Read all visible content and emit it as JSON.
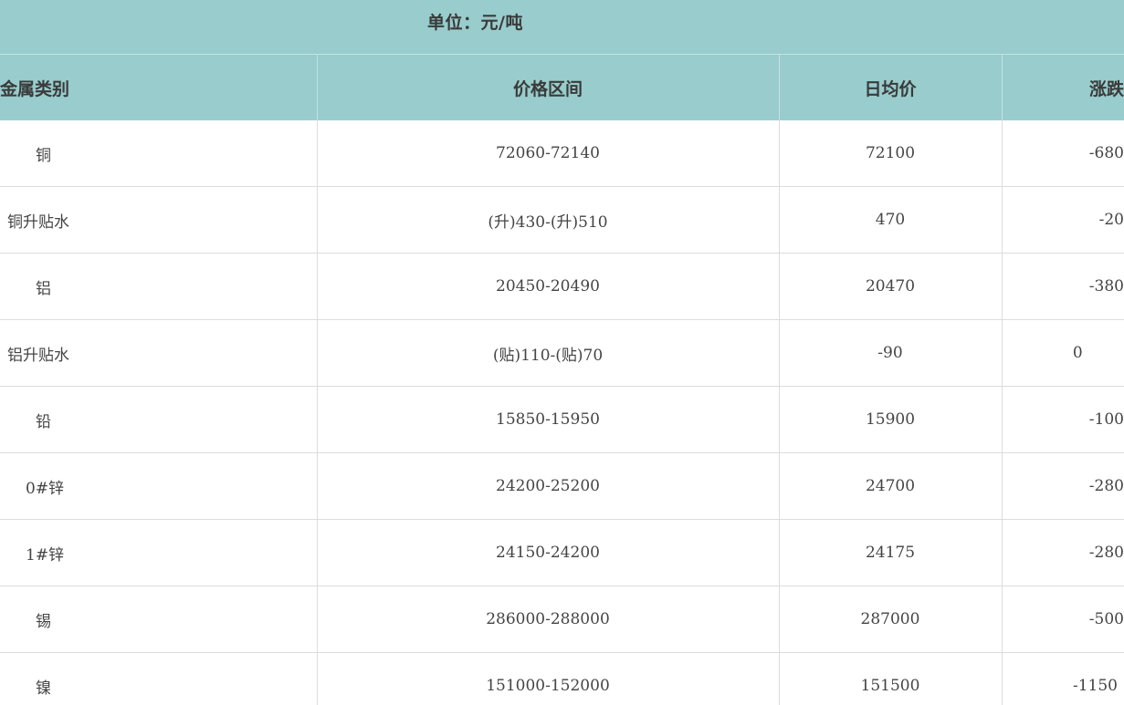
{
  "unit_label": "单位：元/吨",
  "header": {
    "name": "金属类别",
    "range": "价格区间",
    "avg": "日均价",
    "change": "涨跌"
  },
  "rows": [
    {
      "name": "铜",
      "range": "72060-72140",
      "avg": "72100",
      "change": "-680"
    },
    {
      "name": "铜升贴水",
      "range": "(升)430-(升)510",
      "avg": "470",
      "change": "-20"
    },
    {
      "name": "铝",
      "range": "20450-20490",
      "avg": "20470",
      "change": "-380"
    },
    {
      "name": "铝升贴水",
      "range": "(贴)110-(贴)70",
      "avg": "-90",
      "change": "0"
    },
    {
      "name": "铅",
      "range": "15850-15950",
      "avg": "15900",
      "change": "-100"
    },
    {
      "name": "0#锌",
      "range": "24200-25200",
      "avg": "24700",
      "change": "-280"
    },
    {
      "name": "1#锌",
      "range": "24150-24200",
      "avg": "24175",
      "change": "-280"
    },
    {
      "name": "锡",
      "range": "286000-288000",
      "avg": "287000",
      "change": "-500"
    },
    {
      "name": "镍",
      "range": "151000-152000",
      "avg": "151500",
      "change": "-1150"
    }
  ]
}
